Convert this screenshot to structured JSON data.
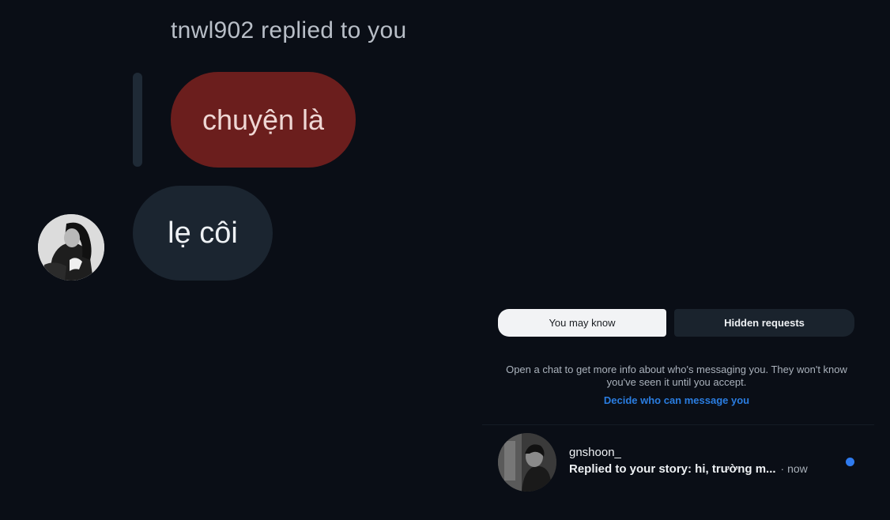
{
  "chat": {
    "reply_header": "tnwl902 replied to you",
    "replied_message": "chuyện là",
    "reply_message": "lẹ côi"
  },
  "requests": {
    "tabs": [
      {
        "label": "You may know",
        "selected": true
      },
      {
        "label": "Hidden requests",
        "selected": false
      }
    ],
    "info": "Open a chat to get more info about who's messaging you. They won't know you've seen it until you accept.",
    "decide_link": "Decide who can message you",
    "items": [
      {
        "username": "gnshoon_",
        "preview": "Replied to your story: hi, trường m...",
        "time": "· now",
        "unread": true
      }
    ]
  },
  "colors": {
    "background": "#0a0e16",
    "replied_bubble": "#6b1e1d",
    "reply_bubble": "#1b2530",
    "link": "#2a7de1",
    "unread_dot": "#2f7bef"
  },
  "icons": {
    "left_avatar": "profile-avatar-icon",
    "right_avatar": "profile-avatar-icon"
  }
}
